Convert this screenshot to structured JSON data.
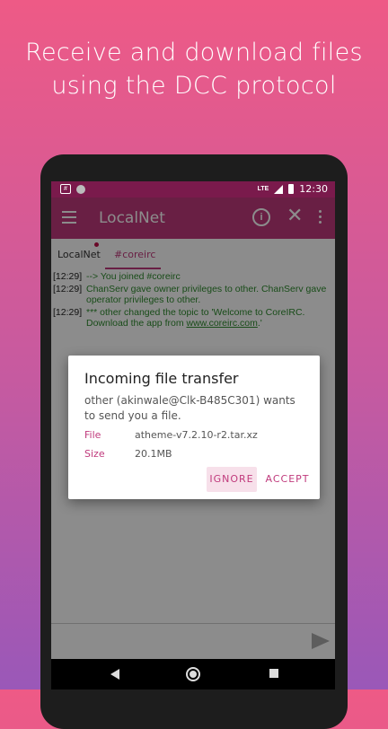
{
  "promo": {
    "line1": "Receive and download files",
    "line2": "using the DCC protocol"
  },
  "status_bar": {
    "time": "12:30",
    "network": "LTE",
    "icons": [
      "message-icon",
      "circle-icon",
      "signal-icon",
      "battery-icon"
    ]
  },
  "toolbar": {
    "title": "LocalNet",
    "info_icon": "i",
    "close_icon": "✕",
    "color": "#c03a7c"
  },
  "tabs": [
    {
      "label": "LocalNet"
    },
    {
      "label": "#coreirc"
    }
  ],
  "chat": {
    "messages": [
      {
        "time": "[12:29]",
        "text": "--> You joined #coreirc"
      },
      {
        "time": "[12:29]",
        "text": "ChanServ gave owner privileges to other. ChanServ gave operator privileges to other."
      },
      {
        "time": "[12:29]",
        "text_before": "*** other changed the topic to 'Welcome to CoreIRC. Download the app from ",
        "link": "www.coreirc.com",
        "text_after": ".'"
      }
    ]
  },
  "dialog": {
    "title": "Incoming file transfer",
    "body": "other (akinwale@Clk-B485C301) wants to send you a file.",
    "file_label": "File",
    "file_value": "atheme-v7.2.10-r2.tar.xz",
    "size_label": "Size",
    "size_value": "20.1MB",
    "ignore_label": "IGNORE",
    "accept_label": "ACCEPT"
  }
}
